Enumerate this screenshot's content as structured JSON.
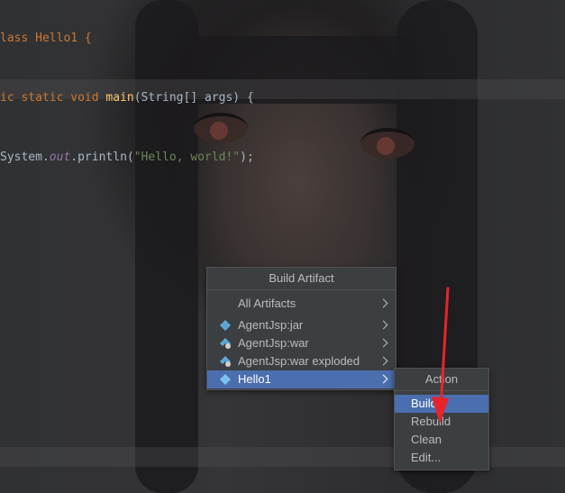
{
  "editor": {
    "lines": [
      {
        "p1": "lass Hello1 {",
        "p1_class": "kw"
      },
      {
        "kw": "ic static void ",
        "fn": "main",
        "rest": "(String[] args) {"
      },
      {
        "pre": "System.",
        "it": "out",
        "mid": ".println(",
        "str": "\"Hello, world!\"",
        "end": ");"
      }
    ]
  },
  "build_menu": {
    "title": "Build Artifact",
    "items": [
      {
        "label": "All Artifacts",
        "icon": "none"
      },
      {
        "label": "AgentJsp:jar",
        "icon": "artifact-icon"
      },
      {
        "label": "AgentJsp:war",
        "icon": "artifact-icon"
      },
      {
        "label": "AgentJsp:war exploded",
        "icon": "artifact-icon"
      },
      {
        "label": "Hello1",
        "icon": "artifact-icon"
      }
    ]
  },
  "action_menu": {
    "title": "Action",
    "items": [
      {
        "label": "Build"
      },
      {
        "label": "Rebuild"
      },
      {
        "label": "Clean"
      },
      {
        "label": "Edit..."
      }
    ]
  },
  "colors": {
    "selection": "#4b6eaf",
    "menu_bg": "#3c3f41",
    "annotation_arrow": "#e8242a"
  }
}
